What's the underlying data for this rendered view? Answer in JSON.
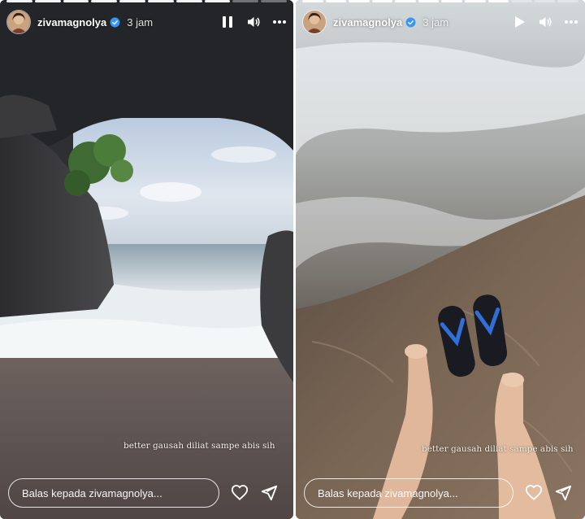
{
  "left_story": {
    "username": "zivamagnolya",
    "time": "3 jam",
    "caption": "better gausah diliat sampe abis sih",
    "reply_placeholder": "Balas kepada zivamagnolya...",
    "playback_state": "playing",
    "progress_total": 10,
    "progress_done": 8
  },
  "right_story": {
    "username": "zivamagnolya",
    "time": "3 jam",
    "caption": "better gausah diliat sampe abis sih",
    "reply_placeholder": "Balas kepada zivamagnolya...",
    "playback_state": "paused",
    "progress_total": 12,
    "progress_done": 9
  },
  "icons": {
    "verified": "verified-badge-icon",
    "pause": "pause-icon",
    "play": "play-icon",
    "volume": "volume-icon",
    "more": "more-options-icon",
    "like": "heart-icon",
    "share": "send-icon"
  },
  "colors": {
    "verified_blue": "#3897f0",
    "text": "#ffffff"
  }
}
